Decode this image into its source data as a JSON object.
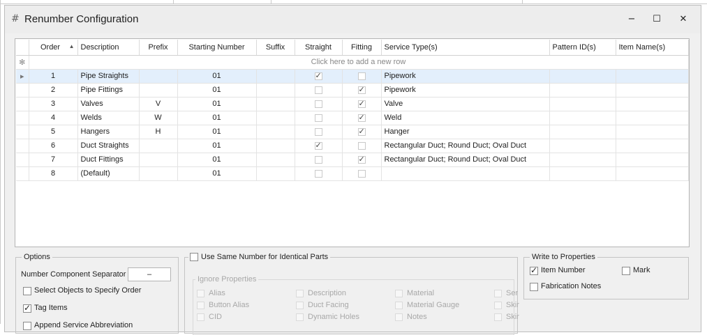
{
  "window": {
    "title": "Renumber Configuration",
    "controls": {
      "minimize": "−",
      "maximize": "☐",
      "close": "✕"
    }
  },
  "grid": {
    "columns": [
      "Order",
      "Description",
      "Prefix",
      "Starting Number",
      "Suffix",
      "Straight",
      "Fitting",
      "Service Type(s)",
      "Pattern ID(s)",
      "Item Name(s)"
    ],
    "new_row_text": "Click here to add a new row",
    "rows": [
      {
        "order": "1",
        "description": "Pipe Straights",
        "prefix": "",
        "starting_number": "01",
        "suffix": "",
        "straight": true,
        "fitting": false,
        "service_types": "Pipework",
        "pattern_ids": "",
        "item_names": ""
      },
      {
        "order": "2",
        "description": "Pipe Fittings",
        "prefix": "",
        "starting_number": "01",
        "suffix": "",
        "straight": false,
        "fitting": true,
        "service_types": "Pipework",
        "pattern_ids": "",
        "item_names": ""
      },
      {
        "order": "3",
        "description": "Valves",
        "prefix": "V",
        "starting_number": "01",
        "suffix": "",
        "straight": false,
        "fitting": true,
        "service_types": "Valve",
        "pattern_ids": "",
        "item_names": ""
      },
      {
        "order": "4",
        "description": "Welds",
        "prefix": "W",
        "starting_number": "01",
        "suffix": "",
        "straight": false,
        "fitting": true,
        "service_types": "Weld",
        "pattern_ids": "",
        "item_names": ""
      },
      {
        "order": "5",
        "description": "Hangers",
        "prefix": "H",
        "starting_number": "01",
        "suffix": "",
        "straight": false,
        "fitting": true,
        "service_types": "Hanger",
        "pattern_ids": "",
        "item_names": ""
      },
      {
        "order": "6",
        "description": "Duct Straights",
        "prefix": "",
        "starting_number": "01",
        "suffix": "",
        "straight": true,
        "fitting": false,
        "service_types": "Rectangular Duct; Round Duct; Oval Duct",
        "pattern_ids": "",
        "item_names": ""
      },
      {
        "order": "7",
        "description": "Duct Fittings",
        "prefix": "",
        "starting_number": "01",
        "suffix": "",
        "straight": false,
        "fitting": true,
        "service_types": "Rectangular Duct; Round Duct; Oval Duct",
        "pattern_ids": "",
        "item_names": ""
      },
      {
        "order": "8",
        "description": "(Default)",
        "prefix": "",
        "starting_number": "01",
        "suffix": "",
        "straight": false,
        "fitting": false,
        "service_types": "",
        "pattern_ids": "",
        "item_names": ""
      }
    ]
  },
  "options": {
    "title": "Options",
    "separator_label": "Number Component Separator",
    "separator_value": "–",
    "select_objects_label": "Select Objects to Specify Order",
    "select_objects_checked": false,
    "tag_items_label": "Tag Items",
    "tag_items_checked": true,
    "append_service_label": "Append Service Abbreviation",
    "append_service_checked": false
  },
  "identical": {
    "use_same_label": "Use Same Number for Identical Parts",
    "use_same_checked": false,
    "ignore_title": "Ignore Properties",
    "col1": [
      "Alias",
      "Button Alias",
      "CID"
    ],
    "col2": [
      "Description",
      "Duct Facing",
      "Dynamic Holes"
    ],
    "col3": [
      "Material",
      "Material Gauge",
      "Notes"
    ],
    "col4": [
      "Ser",
      "Skir",
      "Skir"
    ]
  },
  "write": {
    "title": "Write to Properties",
    "item_number_label": "Item Number",
    "item_number_checked": true,
    "mark_label": "Mark",
    "mark_checked": false,
    "fab_notes_label": "Fabrication Notes",
    "fab_notes_checked": false
  }
}
